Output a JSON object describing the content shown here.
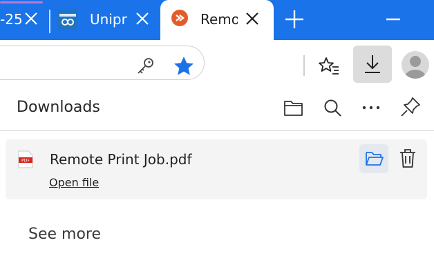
{
  "tabs": [
    {
      "label": "-25",
      "state": "partial",
      "close_glyph": "close-icon"
    },
    {
      "label": "Unipri",
      "state": "inactive",
      "favicon": "uniprint-favicon",
      "close_glyph": "close-icon"
    },
    {
      "label": "Remo",
      "state": "active",
      "favicon": "remote-desktop-favicon",
      "close_glyph": "close-icon"
    }
  ],
  "tabbar": {
    "new_tab_icon": "plus-icon",
    "minimize_icon": "minimize-icon"
  },
  "toolbar": {
    "address_icons": [
      "key-icon",
      "star-filled-icon"
    ],
    "right_icons": [
      "favorites-icon",
      "download-icon",
      "profile-avatar"
    ]
  },
  "downloads": {
    "title": "Downloads",
    "header_icons": [
      "open-folder-icon",
      "search-icon",
      "more-icon",
      "pin-icon"
    ],
    "items": [
      {
        "file_type": "PDF",
        "filename": "Remote Print Job.pdf",
        "action_label": "Open file"
      }
    ],
    "see_more_label": "See more"
  },
  "colors": {
    "tabbar_bg": "#1a73e8",
    "star_blue": "#1a73e8",
    "pdf_red": "#d9261c",
    "remote_favicon": "#e25c2a"
  }
}
